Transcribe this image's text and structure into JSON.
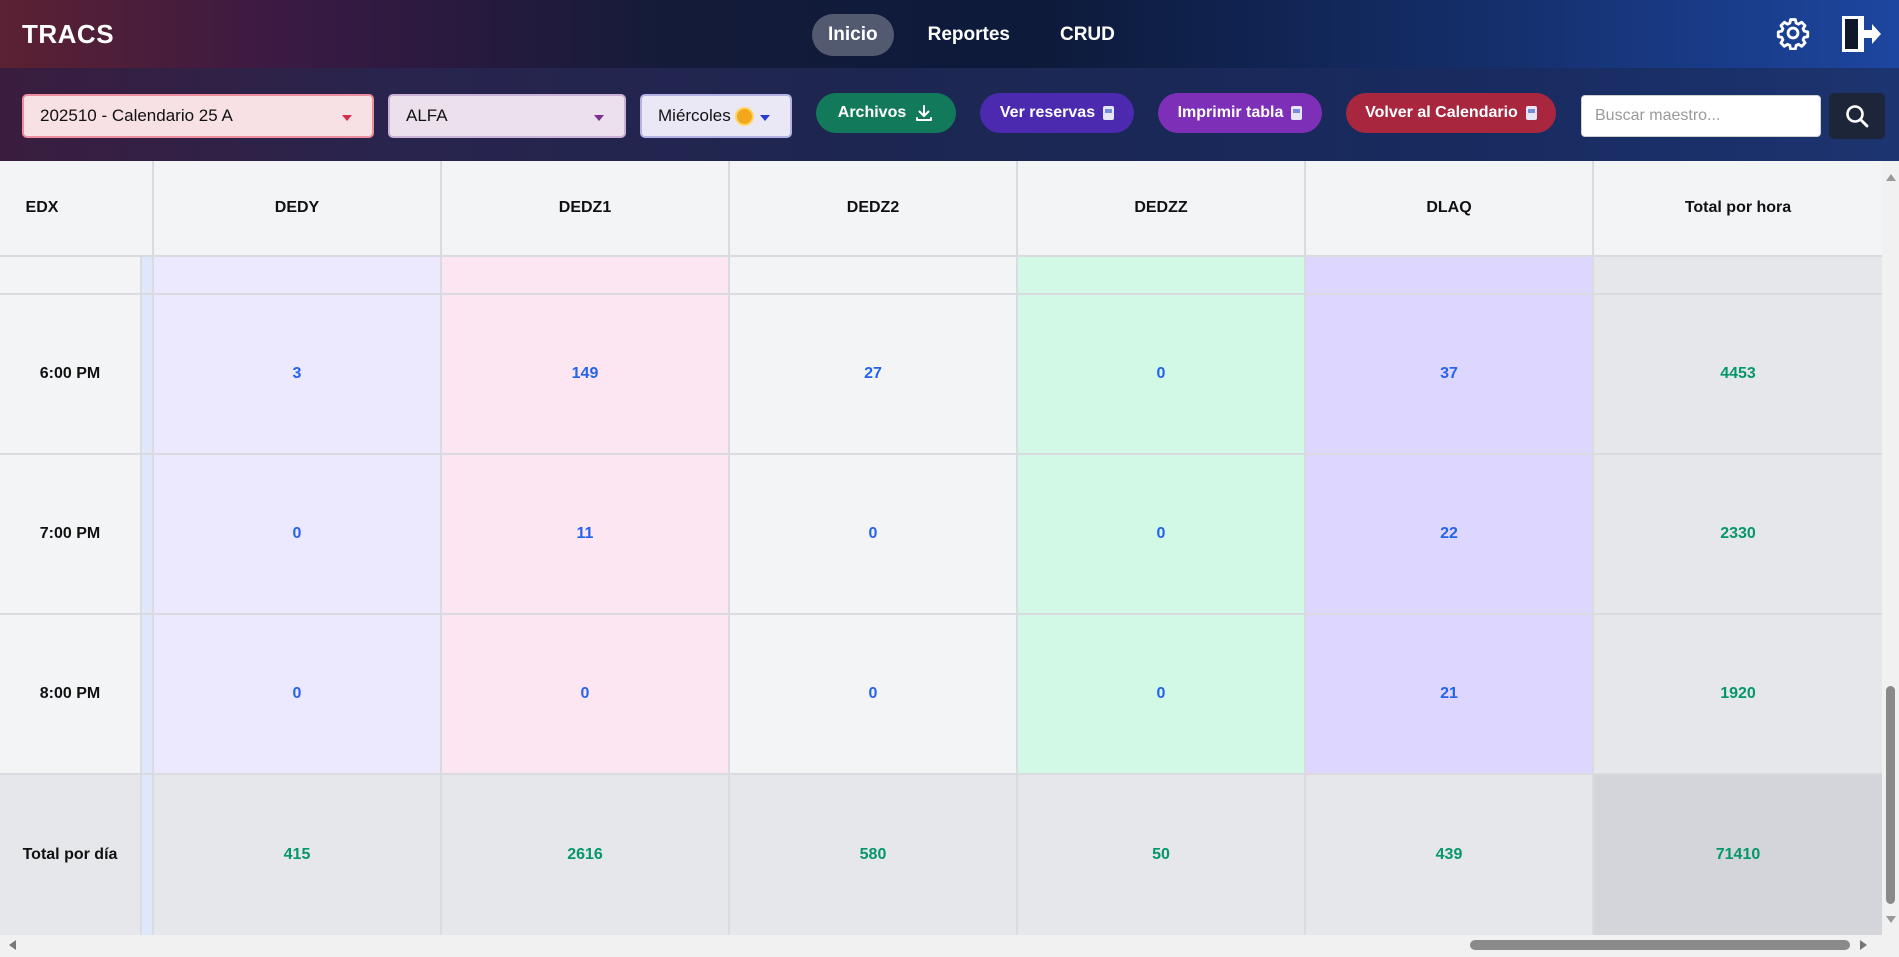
{
  "app": {
    "brand": "TRACS"
  },
  "nav": {
    "items": [
      "Inicio",
      "Reportes",
      "CRUD"
    ],
    "active": "Inicio"
  },
  "toolbar": {
    "calendar_select": "202510 - Calendario 25 A",
    "group_select": "ALFA",
    "day_select": "Miércoles",
    "archivos_label": "Archivos",
    "reservas_label": "Ver reservas",
    "imprimir_label": "Imprimir tabla",
    "volver_label": "Volver al Calendario",
    "search_placeholder": "Buscar maestro...",
    "search_value": ""
  },
  "table": {
    "partial_column_header": "EDX",
    "columns": [
      "DEDY",
      "DEDZ1",
      "DEDZ2",
      "DEDZZ",
      "DLAQ",
      "Total por hora"
    ],
    "rows": [
      {
        "hour": "6:00 PM",
        "values": [
          "3",
          "149",
          "27",
          "0",
          "37"
        ],
        "total": "4453"
      },
      {
        "hour": "7:00 PM",
        "values": [
          "0",
          "11",
          "0",
          "0",
          "22"
        ],
        "total": "2330"
      },
      {
        "hour": "8:00 PM",
        "values": [
          "0",
          "0",
          "0",
          "0",
          "21"
        ],
        "total": "1920"
      }
    ],
    "totals_row": {
      "label": "Total por día",
      "values": [
        "415",
        "2616",
        "580",
        "50",
        "439"
      ],
      "grand_total": "71410"
    }
  },
  "colors": {
    "brand_gradient_left": "#5c2133",
    "brand_gradient_right": "#1d46a0",
    "number_blue": "#2563eb",
    "total_green": "#059669"
  },
  "icons": [
    "gear-icon",
    "logout-icon",
    "download-icon",
    "search-icon",
    "sun-icon"
  ]
}
